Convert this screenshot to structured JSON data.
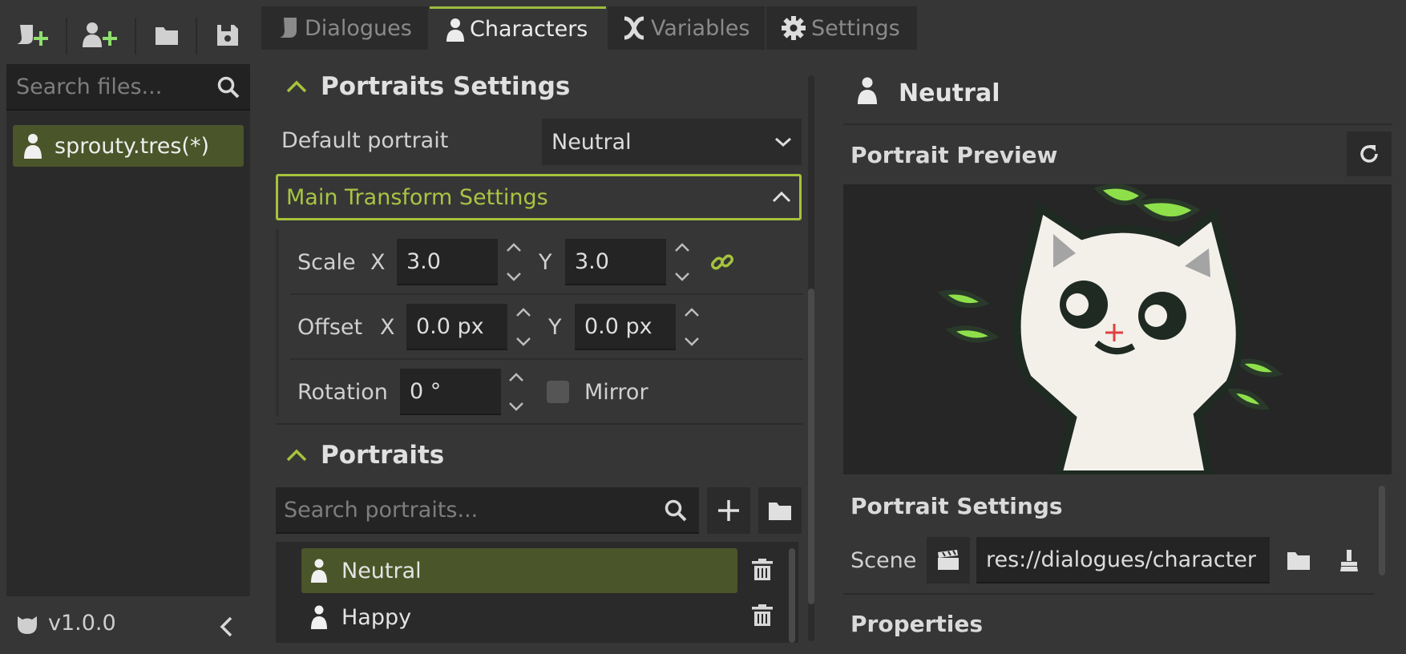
{
  "toolbar": {
    "buttons": [
      {
        "name": "new-timeline-button",
        "icon": "add-timeline-icon"
      },
      {
        "name": "new-character-button",
        "icon": "add-character-icon"
      },
      {
        "name": "open-file-button",
        "icon": "folder-icon"
      },
      {
        "name": "save-button",
        "icon": "save-icon"
      }
    ]
  },
  "tabs": [
    {
      "label": "Dialogues",
      "icon": "timeline-icon",
      "active": false
    },
    {
      "label": "Characters",
      "icon": "character-icon",
      "active": true
    },
    {
      "label": "Variables",
      "icon": "variable-icon",
      "active": false
    },
    {
      "label": "Settings",
      "icon": "gear-icon",
      "active": false
    }
  ],
  "sidebar": {
    "search_placeholder": "Search files...",
    "files": [
      {
        "label": "sprouty.tres(*)",
        "selected": true
      }
    ],
    "version": "v1.0.0"
  },
  "portraits_settings": {
    "header": "Portraits Settings",
    "default_portrait_label": "Default portrait",
    "default_portrait_value": "Neutral",
    "main_transform_label": "Main Transform Settings",
    "scale": {
      "label": "Scale",
      "x_label": "X",
      "x": "3.0",
      "y_label": "Y",
      "y": "3.0"
    },
    "offset": {
      "label": "Offset",
      "x_label": "X",
      "x": "0.0 px",
      "y_label": "Y",
      "y": "0.0 px"
    },
    "rotation": {
      "label": "Rotation",
      "value": "0 °"
    },
    "mirror": {
      "label": "Mirror",
      "checked": false
    }
  },
  "portraits": {
    "header": "Portraits",
    "search_placeholder": "Search portraits...",
    "items": [
      {
        "label": "Neutral",
        "selected": true
      },
      {
        "label": "Happy",
        "selected": false
      }
    ]
  },
  "right": {
    "portrait_name": "Neutral",
    "preview_title": "Portrait Preview",
    "portrait_settings_title": "Portrait Settings",
    "scene_label": "Scene",
    "scene_value": "res://dialogues/character",
    "properties_title": "Properties"
  },
  "colors": {
    "accent": "#a6c23c",
    "selection": "#4a5529",
    "background": "#363636",
    "panel": "#2a2a2a"
  }
}
